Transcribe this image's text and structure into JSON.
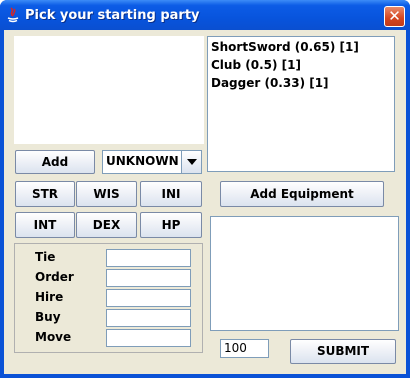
{
  "window": {
    "title": "Pick your starting party"
  },
  "stats_buttons": [
    "STR",
    "WIS",
    "INI",
    "INT",
    "DEX",
    "HP"
  ],
  "add_button_label": "Add",
  "class_combo": {
    "selected": "UNKNOWN"
  },
  "equipment_list": [
    "ShortSword (0.65) [1]",
    "Club (0.5) [1]",
    "Dagger (0.33) [1]"
  ],
  "add_equipment_label": "Add Equipment",
  "form_fields": {
    "tie": "Tie",
    "order": "Order",
    "hire": "Hire",
    "buy": "Buy",
    "move": "Move"
  },
  "gold_value": "100",
  "submit_label": "SUBMIT"
}
